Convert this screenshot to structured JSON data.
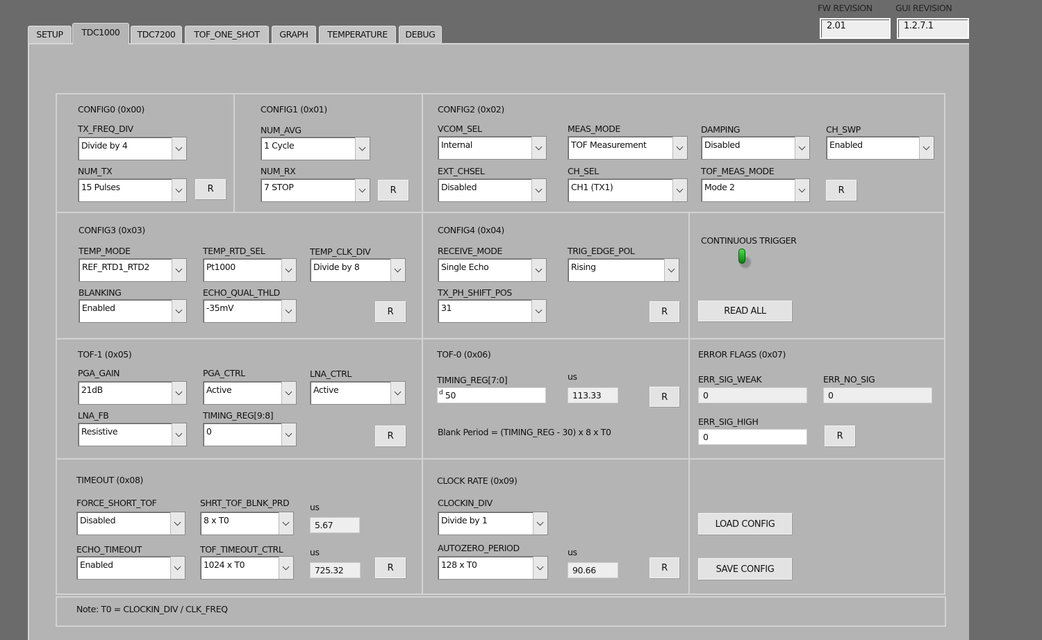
{
  "tabs": [
    "SETUP",
    "TDC1000",
    "TDC7200",
    "TOF_ONE_SHOT",
    "GRAPH",
    "TEMPERATURE",
    "DEBUG"
  ],
  "active_tab": "TDC1000",
  "revisions": {
    "fw_label": "FW REVISION",
    "fw_value": "2.01",
    "gui_label": "GUI REVISION",
    "gui_value": "1.2.7.1"
  },
  "r_label": "R",
  "config0": {
    "title": "CONFIG0 (0x00)",
    "tx_freq_div_label": "TX_FREQ_DIV",
    "tx_freq_div": "Divide by 4",
    "num_tx_label": "NUM_TX",
    "num_tx": "15 Pulses"
  },
  "config1": {
    "title": "CONFIG1 (0x01)",
    "num_avg_label": "NUM_AVG",
    "num_avg": "1 Cycle",
    "num_rx_label": "NUM_RX",
    "num_rx": "7 STOP"
  },
  "config2": {
    "title": "CONFIG2 (0x02)",
    "vcom_sel_label": "VCOM_SEL",
    "vcom_sel": "Internal",
    "meas_mode_label": "MEAS_MODE",
    "meas_mode": "TOF Measurement",
    "damping_label": "DAMPING",
    "damping": "Disabled",
    "ch_swp_label": "CH_SWP",
    "ch_swp": "Enabled",
    "ext_chsel_label": "EXT_CHSEL",
    "ext_chsel": "Disabled",
    "ch_sel_label": "CH_SEL",
    "ch_sel": "CH1 (TX1)",
    "tof_meas_mode_label": "TOF_MEAS_MODE",
    "tof_meas_mode": "Mode 2"
  },
  "config3": {
    "title": "CONFIG3 (0x03)",
    "temp_mode_label": "TEMP_MODE",
    "temp_mode": "REF_RTD1_RTD2",
    "temp_rtd_sel_label": "TEMP_RTD_SEL",
    "temp_rtd_sel": "Pt1000",
    "temp_clk_div_label": "TEMP_CLK_DIV",
    "temp_clk_div": "Divide by 8",
    "blanking_label": "BLANKING",
    "blanking": "Enabled",
    "echo_qual_thld_label": "ECHO_QUAL_THLD",
    "echo_qual_thld": "-35mV"
  },
  "config4": {
    "title": "CONFIG4 (0x04)",
    "receive_mode_label": "RECEIVE_MODE",
    "receive_mode": "Single Echo",
    "trig_edge_pol_label": "TRIG_EDGE_POL",
    "trig_edge_pol": "Rising",
    "tx_ph_shift_pos_label": "TX_PH_SHIFT_POS",
    "tx_ph_shift_pos": "31"
  },
  "trigger": {
    "label": "CONTINUOUS TRIGGER",
    "on": true,
    "read_all": "READ ALL",
    "color": "#1fa01f"
  },
  "tof1": {
    "title": "TOF-1 (0x05)",
    "pga_gain_label": "PGA_GAIN",
    "pga_gain": "21dB",
    "pga_ctrl_label": "PGA_CTRL",
    "pga_ctrl": "Active",
    "lna_ctrl_label": "LNA_CTRL",
    "lna_ctrl": "Active",
    "lna_fb_label": "LNA_FB",
    "lna_fb": "Resistive",
    "timing_reg_hi_label": "TIMING_REG[9:8]",
    "timing_reg_hi": "0"
  },
  "tof0": {
    "title": "TOF-0 (0x06)",
    "timing_reg_lo_label": "TIMING_REG[7:0]",
    "radix": "d",
    "timing_reg_lo": "50",
    "us_label": "us",
    "us_value": "113.33",
    "formula": "Blank Period = (TIMING_REG - 30) x 8 x T0"
  },
  "errors": {
    "title": "ERROR FLAGS (0x07)",
    "sig_weak_label": "ERR_SIG_WEAK",
    "sig_weak": "0",
    "no_sig_label": "ERR_NO_SIG",
    "no_sig": "0",
    "sig_high_label": "ERR_SIG_HIGH",
    "sig_high": "0"
  },
  "timeout": {
    "title": "TIMEOUT (0x08)",
    "force_short_tof_label": "FORCE_SHORT_TOF",
    "force_short_tof": "Disabled",
    "shrt_tof_blnk_prd_label": "SHRT_TOF_BLNK_PRD",
    "shrt_tof_blnk_prd": "8 x T0",
    "us1_label": "us",
    "us1_value": "5.67",
    "echo_timeout_label": "ECHO_TIMEOUT",
    "echo_timeout": "Enabled",
    "tof_timeout_ctrl_label": "TOF_TIMEOUT_CTRL",
    "tof_timeout_ctrl": "1024 x T0",
    "us2_label": "us",
    "us2_value": "725.32"
  },
  "clock": {
    "title": "CLOCK RATE (0x09)",
    "clockin_div_label": "CLOCKIN_DIV",
    "clockin_div": "Divide by 1",
    "autozero_period_label": "AUTOZERO_PERIOD",
    "autozero_period": "128 x T0",
    "us_label": "us",
    "us_value": "90.66"
  },
  "config_buttons": {
    "load": "LOAD CONFIG",
    "save": "SAVE CONFIG"
  },
  "note": "Note: T0 = CLOCKIN_DIV / CLK_FREQ"
}
